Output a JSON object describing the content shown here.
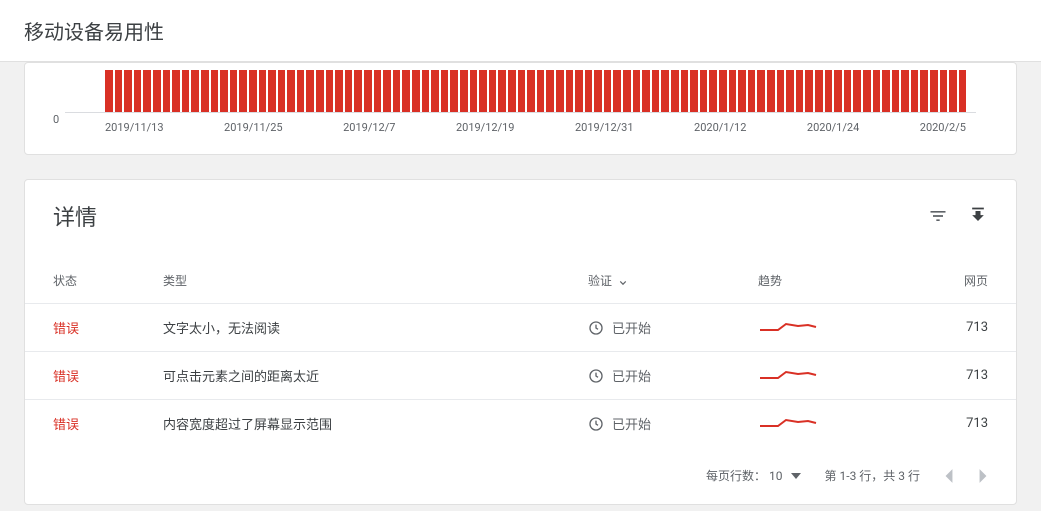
{
  "header": {
    "title": "移动设备易用性"
  },
  "chart_data": {
    "type": "bar",
    "categories": [
      "2019/11/13",
      "2019/11/25",
      "2019/12/7",
      "2019/12/19",
      "2019/12/31",
      "2020/1/12",
      "2020/1/24",
      "2020/2/5"
    ],
    "values": [
      713,
      713,
      713,
      713,
      713,
      713,
      713,
      713,
      713,
      713,
      713,
      713,
      713,
      713,
      713,
      713,
      713,
      713,
      713,
      713,
      713,
      713,
      713,
      713,
      713,
      713,
      713,
      713,
      713,
      713,
      713,
      713,
      713,
      713,
      713,
      713,
      713,
      713,
      713,
      713,
      713,
      713,
      713,
      713,
      713,
      713,
      713,
      713,
      713,
      713,
      713,
      713,
      713,
      713,
      713,
      713,
      713,
      713,
      713,
      713,
      713,
      713,
      713,
      713,
      713,
      713,
      713,
      713,
      713,
      713,
      713,
      713,
      713,
      713,
      713,
      713,
      713,
      713,
      713,
      713,
      713,
      713,
      713,
      713,
      713,
      713,
      713,
      713,
      713,
      713
    ],
    "y_tick": 0,
    "ylabel": "",
    "xlabel": "",
    "ylim": [
      0,
      800
    ]
  },
  "details": {
    "title": "详情",
    "columns": {
      "status": "状态",
      "type": "类型",
      "validation": "验证",
      "trend": "趋势",
      "pages": "网页"
    },
    "rows": [
      {
        "status": "错误",
        "type": "文字太小，无法阅读",
        "validation": "已开始",
        "pages": "713"
      },
      {
        "status": "错误",
        "type": "可点击元素之间的距离太近",
        "validation": "已开始",
        "pages": "713"
      },
      {
        "status": "错误",
        "type": "内容宽度超过了屏幕显示范围",
        "validation": "已开始",
        "pages": "713"
      }
    ]
  },
  "pagination": {
    "rows_per_page_label": "每页行数：",
    "rows_per_page": "10",
    "range_text": "第 1-3 行，共 3 行"
  }
}
